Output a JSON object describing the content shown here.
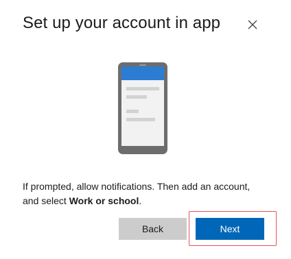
{
  "dialog": {
    "title": "Set up your account in app",
    "message_prefix": "If prompted, allow notifications. Then add an account, and select ",
    "message_bold": "Work or school",
    "message_suffix": ".",
    "back_label": "Back",
    "next_label": "Next"
  },
  "icons": {
    "close": "close-icon",
    "illustration": "phone-illustration"
  },
  "colors": {
    "primary": "#0067b8",
    "secondary_button": "#cccccc",
    "highlight": "#e0545e",
    "phone_frame": "#6d6d6d",
    "phone_header": "#2b7cd3"
  }
}
